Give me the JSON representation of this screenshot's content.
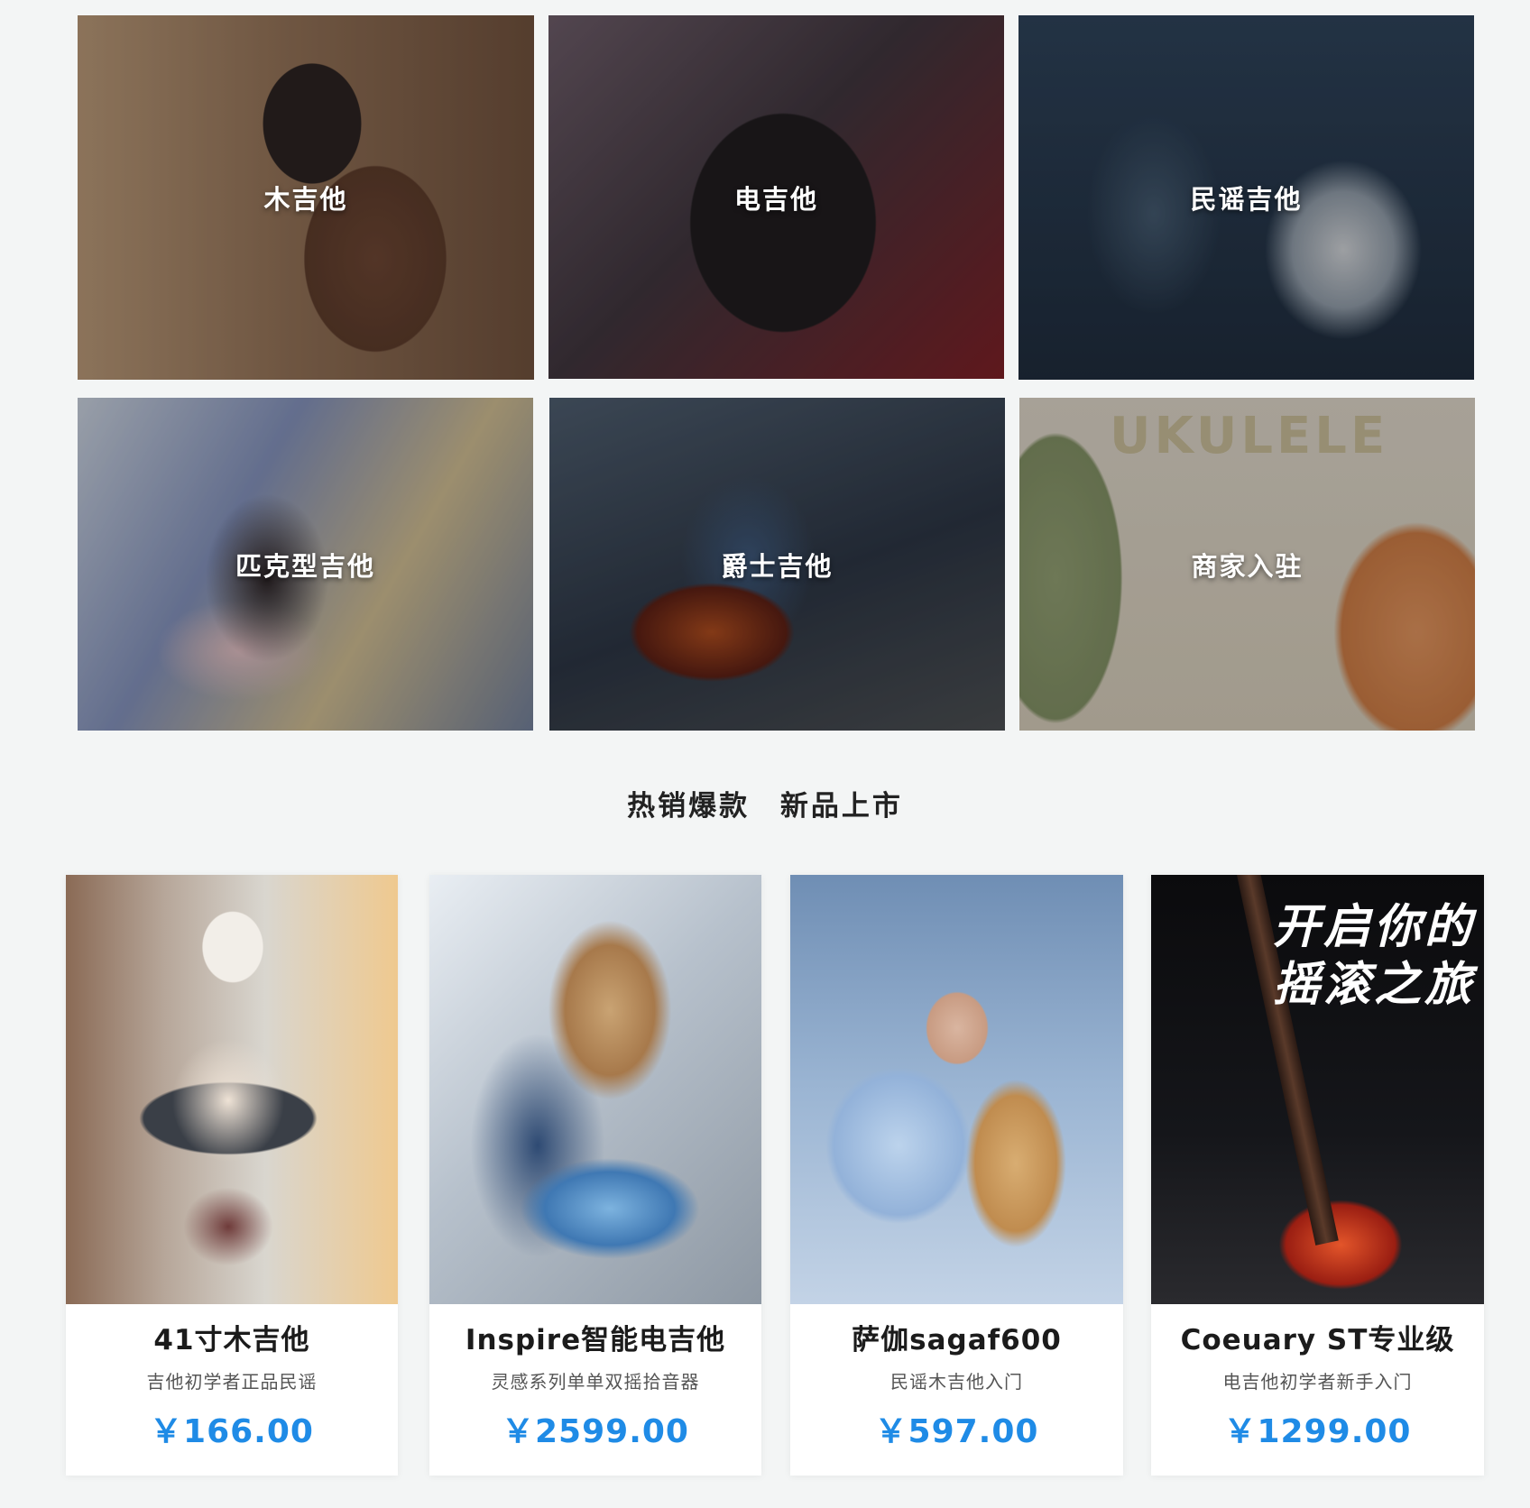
{
  "categories": [
    {
      "label": "木吉他"
    },
    {
      "label": "电吉他"
    },
    {
      "label": "民谣吉他"
    },
    {
      "label": "匹克型吉他"
    },
    {
      "label": "爵士吉他"
    },
    {
      "label": "商家入驻",
      "overlay_text": "UKULELE"
    }
  ],
  "section": {
    "heading_left": "热销爆款",
    "heading_right": "新品上市"
  },
  "products": [
    {
      "title": "41寸木吉他",
      "subtitle": "吉他初学者正品民谣",
      "price": "￥166.00"
    },
    {
      "title": "Inspire智能电吉他",
      "subtitle": "灵感系列单单双摇拾音器",
      "price": "￥2599.00"
    },
    {
      "title": "萨伽sagaf600",
      "subtitle": "民谣木吉他入门",
      "price": "￥597.00"
    },
    {
      "title": "Coeuary ST专业级",
      "subtitle": "电吉他初学者新手入门",
      "price": "￥1299.00",
      "photo_slogan": "开启你的摇滚之旅"
    }
  ],
  "colors": {
    "background": "#f3f5f5",
    "price": "#1f8be6",
    "title": "#1b1b1b",
    "subtitle": "#555555"
  }
}
